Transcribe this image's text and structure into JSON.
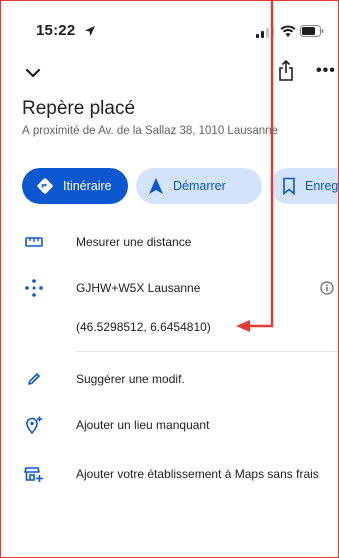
{
  "status_bar": {
    "time": "15:22"
  },
  "place": {
    "title": "Repère placé",
    "address": "À proximité de Av. de la Sallaz 38, 1010 Lausanne"
  },
  "actions": {
    "directions": "Itinéraire",
    "start": "Démarrer",
    "save": "Enregistrer"
  },
  "list": {
    "measure": "Mesurer une distance",
    "plus_code": "GJHW+W5X Lausanne",
    "coordinates": "(46.5298512, 6.6454810)",
    "suggest_edit": "Suggérer une modif.",
    "add_place": "Ajouter un lieu manquant",
    "add_business": "Ajouter votre établissement à Maps sans frais"
  },
  "colors": {
    "primary": "#0b57d0",
    "chip_light": "#d3e3fd",
    "annotation": "#e53935",
    "text": "#1f1f1f",
    "muted": "#5f6368"
  },
  "icons": [
    "location-arrow-icon",
    "signal-icon",
    "wifi-icon",
    "battery-icon",
    "chevron-down-icon",
    "share-icon",
    "more-icon",
    "directions-icon",
    "navigation-arrow-icon",
    "bookmark-icon",
    "ruler-icon",
    "plus-code-icon",
    "info-icon",
    "pencil-icon",
    "add-place-icon",
    "add-business-icon"
  ]
}
